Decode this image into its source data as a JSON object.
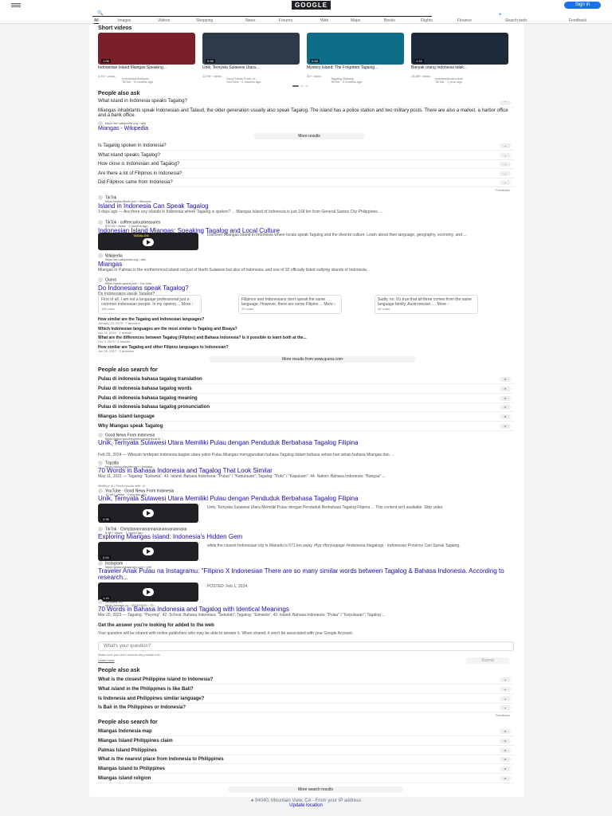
{
  "header": {
    "logo_text": "GOOGLE",
    "signin_label": "Sign in",
    "search_query": ""
  },
  "nav": {
    "tabs": [
      "All",
      "Images",
      "Videos",
      "Shopping",
      "News",
      "Forums",
      "Web",
      "Maps",
      "Books",
      "Flights",
      "Finance"
    ],
    "search_tools": "Search tools",
    "feedback": "Feedback"
  },
  "short_videos": {
    "heading": "Short videos",
    "items": [
      {
        "title": "Indonesian Island Miangas Speaking...",
        "views": "2.4K+ views",
        "source": "Indonesianfunfacts",
        "platform": "TikTok · 3 months ago",
        "duration": "1:08",
        "thumb_color": "#7b1f2b"
      },
      {
        "title": "Unik, Ternyata Sulawesi Utara...",
        "views": "12.9K+ views",
        "source": "Good News From In...",
        "platform": "YouTube · 2 months ago",
        "duration": "0:38",
        "thumb_color": "#2d3a4a"
      },
      {
        "title": "Mystery Island: The Forgotten Tagalog...",
        "views": "30+ views",
        "source": "Tagalog Mystery",
        "platform": "TikTok · 2 months ago",
        "duration": "0:48",
        "thumb_color": "#0e6e8a"
      },
      {
        "title": "Banyak orang Indonesia tidak...",
        "views": "28.8K+ views",
        "source": "Indonesiatrueunkno",
        "platform": "TikTok · 1 year ago",
        "duration": "1:15",
        "thumb_color": "#1d2a3a"
      }
    ]
  },
  "paa1": {
    "heading": "People also ask",
    "open_question": "What island in Indonesia speaks Tagalog?",
    "answer": "Miangas inhabitants speak Indonesian and Talaud, the older generation usually also speak Tagalog. The island has a police station and two military posts. There are also a market, a harbor office and a bank office.",
    "answer_url": "https://en.wikipedia.org › wiki",
    "answer_link": "Miangas - Wikipedia",
    "more_results": "More results",
    "questions": [
      "Is Tagalog spoken in Indonesia?",
      "What island speaks Tagalog?",
      "How close is Indonesian and Tagalog?",
      "Are there a lot of Filipinos in Indonesia?",
      "Did Filipinos came from Indonesia?"
    ],
    "feedback": "Feedback"
  },
  "results": [
    {
      "site": "TikTok",
      "url": "https://www.tiktok.com › discover",
      "title": "Island in Indonesia Can Speak Tagalog",
      "snippet": "3 days ago — Are there any islands in Indonesia where Tagalog is spoken? ... Miangas Island of Indonesia is just 168 km from General Santos City Philippines, ..."
    },
    {
      "site": "TikTok · coffeecurioustreasures",
      "url": "570 10+ views · 3 months ago",
      "title": "Indonesian Island Miangas: Speaking Tagalog and Local Culture",
      "snippet": "Discover Miangas Island in Indonesia where locals speak Tagalog and the diverse culture. Learn about their language, geography, economy, and ...",
      "video_label": "TAGALOG"
    },
    {
      "site": "Wikipedia",
      "url": "https://en.wikipedia.org › wiki",
      "title": "Miangas",
      "snippet": "Miangas or Palmas is the northernmost island not just of North Sulawesi but also of Indonesia, and one of 92 officially listed outlying islands of Indonesia."
    },
    {
      "site": "Quora",
      "url": "https://www.quora.com › Do-Indo...",
      "title": "Do Indonesians speak Tagalog?",
      "snippet": "Do Indonesians speak Tagalog?"
    }
  ],
  "quora": {
    "answers": [
      {
        "text": "First of all, I am not a language professional just a common Indonesian people. In my opinion ... More ›",
        "votes": "185 votes"
      },
      {
        "text": "Filipinos and Indonesians don't speak the same language. However, there are some Filipino ... More ›",
        "votes": "23 votes"
      },
      {
        "text": "Sadly, no. It's true that all three comes from the same language family, Austronesian. ... More ›",
        "votes": "40 votes"
      }
    ],
    "related": [
      {
        "q": "How similar are the Tagalog and Indonesian languages?",
        "meta": "January 29, 2020 · 7 answers"
      },
      {
        "q": "Which Indonesian languages are the most similar to Tagalog and Bisaya?",
        "meta": "Apr 15, 2024 · 1 answer"
      },
      {
        "q": "What are the differences between Tagalog (Filipino) and Bahasa Indonesia? Is it possible to learn both at the...",
        "meta": "Oct 3, 2023 · 1 answer"
      },
      {
        "q": "How similar are Tagalog and other Filipino languages to Indonesian?",
        "meta": "Jun 16, 2017 · 3 answers"
      }
    ],
    "more": "More results from www.quora.com"
  },
  "pas1": {
    "heading": "People also search for",
    "items": [
      "Pulau di indonesia bahasa tagalog translation",
      "Pulau di indonesia bahasa tagalog words",
      "Pulau di indonesia bahasa tagalog meaning",
      "Pulau di indonesia bahasa tagalog pronunciation",
      "Miangas Island language",
      "Why Miangas speak Tagalog"
    ]
  },
  "results2": [
    {
      "site": "Good News From Indonesia",
      "url": "https://www.goodnewsfromindonesia.id ›...",
      "title": "Unik, Ternyata Sulawesi Utara Memiliki Pulau dengan Penduduk Berbahasa Tagalog Filipina",
      "snippet": "Feb 29, 2024 — Wilayah terdepan Indonesia bagian utara yakni Pulau Miangas menggunakan bahasa Tagalog dalam bahasa sehari-hari selain bahasa Miangas dan ..."
    },
    {
      "site": "Tripzilla",
      "url": "https://www.tripzilla.com › bahasa...",
      "title": "70 Words in Bahasa Indonesia and Tagalog That Look Similar",
      "snippet": "May 11, 2021 — Tagalog: \"Eskwela\". 43. Island: Bahasa Indonesia: \"Pulau\" / \"Kepulauan\"; Tagalog: \"Pulo\" / \"Kapuluan\". 44. Nation: Bahasa Indonesia: \"Bangsa\" ...",
      "missing": "Missing: di | Show results with: di"
    },
    {
      "site": "YouTube · Good News From Indonesia",
      "url": "12.9K+ views · 2 months ago",
      "title": "Unik, Ternyata Sulawesi Utara Memiliki Pulau dengan Penduduk Berbahasa Tagalog Filipina",
      "snippet": "Unik, Ternyata Sulawesi Utara Memiliki Pulau dengan Penduduk Berbahasa Tagalog Filipina ... This content isn't available. Skip video.",
      "duration": "0:38"
    },
    {
      "site": "TikTok · Christianannanannananannanannana",
      "url": "8.8K+ views · 1 month ago",
      "title": "Exploring Miangas Island: Indonesia's Hidden Gem",
      "snippet": "while the closest Indonesian city is Manado is 571 km away. #fyp #foryoupage #indonesia #tagalogs · Indonesian Province Can Speak Tagalog.",
      "duration": "0:54"
    },
    {
      "site": "Instagram",
      "url": "https://www.instagram.com › reel",
      "title": "Traveler Anak Pulau na Instagramu: \"Filipino X Indonesian There are so many similar words between Tagalog & Bahasa Indonesia. According to research...",
      "snippet": "POSTED: Feb 1, 2024",
      "duration": "1:15"
    },
    {
      "site": "Seasia.co",
      "url": "https://seasia.co › 2023/03/20 › 70...",
      "title": "70 Words in Bahasa Indonesia and Tagalog with Identical Meanings",
      "snippet": "Mar 20, 2023 — Tagalog: \"Payong\". 42. School: Bahasa Indonesia: \"Sekolah\"; Tagalog: \"Eskwela\". 43. Island: Bahasa Indonesia: \"Pulau\" / \"Kepulauan\"; Tagalog ..."
    }
  ],
  "ask": {
    "heading": "Get the answer you're looking for added to the web",
    "desc": "Your question will be shared with online publishers who may be able to answer it. When shared, it won't be associated with your Google Account.",
    "placeholder": "What's your question?",
    "note": "Make sure you don't include any private info",
    "learn": "Learn more",
    "submit": "Submit"
  },
  "paa2": {
    "heading": "People also ask",
    "questions": [
      "What is the closest Philippine island to Indonesia?",
      "What island in the Philippines is like Bali?",
      "Is Indonesia and Philippines similar language?",
      "Is Bali in the Philippines or Indonesia?"
    ],
    "feedback": "Feedback"
  },
  "pas2": {
    "heading": "People also search for",
    "items": [
      "Miangas Indonesia map",
      "Miangas Island Philippines claim",
      "Palmas Island Philippines",
      "What is the nearest place from Indonesia to Philippines",
      "Miangas Island to Philippines",
      "Miangas island religion"
    ],
    "more": "More search results"
  },
  "footer": {
    "location": "● 94040, Mountain View, CA · From your IP address",
    "update": "Update location"
  }
}
